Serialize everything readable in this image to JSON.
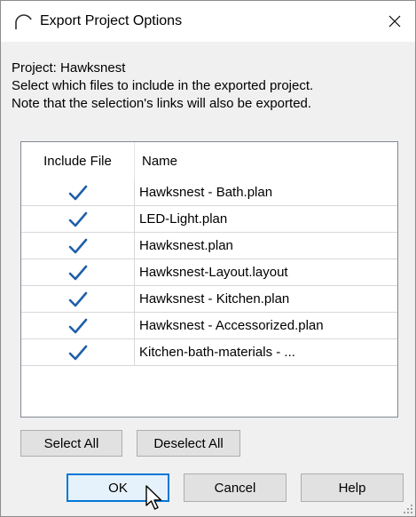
{
  "window": {
    "title": "Export Project Options",
    "icon": "arch-app-icon",
    "close_icon": "close-icon"
  },
  "info": {
    "project_line": "Project: Hawksnest",
    "instruction_1": "Select which files to include in the exported project.",
    "instruction_2": "Note that the selection's links will also be exported."
  },
  "table": {
    "columns": [
      "Include File",
      "Name"
    ],
    "rows": [
      {
        "included": true,
        "name": "Hawksnest - Bath.plan"
      },
      {
        "included": true,
        "name": "LED-Light.plan"
      },
      {
        "included": true,
        "name": "Hawksnest.plan"
      },
      {
        "included": true,
        "name": "Hawksnest-Layout.layout"
      },
      {
        "included": true,
        "name": "Hawksnest - Kitchen.plan"
      },
      {
        "included": true,
        "name": "Hawksnest - Accessorized.plan"
      },
      {
        "included": true,
        "name": "Kitchen-bath-materials - ..."
      }
    ]
  },
  "buttons": {
    "select_all": "Select All",
    "deselect_all": "Deselect All",
    "ok": "OK",
    "cancel": "Cancel",
    "help": "Help"
  },
  "colors": {
    "check": "#1f5fa8",
    "default_button_border": "#0078d7"
  }
}
